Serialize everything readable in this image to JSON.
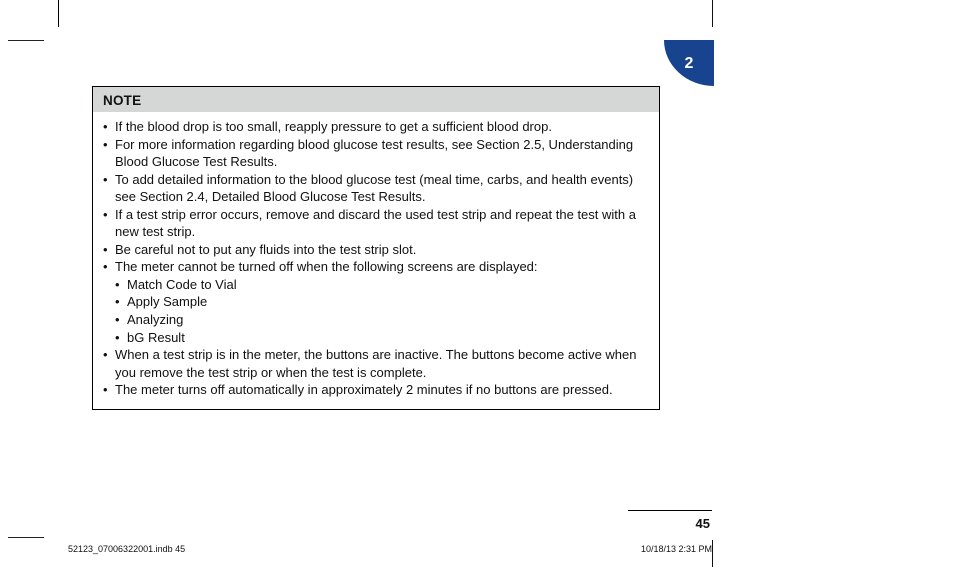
{
  "chapter_number": "2",
  "note": {
    "header": "NOTE",
    "items": [
      {
        "level": 1,
        "text": "If the blood drop is too small, reapply pressure to get a sufficient blood drop."
      },
      {
        "level": 1,
        "text": "For more information regarding blood glucose test results, see Section 2.5, Understanding Blood Glucose Test Results."
      },
      {
        "level": 1,
        "text": "To add detailed information to the blood glucose test (meal time, carbs, and health events) see Section 2.4, Detailed Blood Glucose Test Results."
      },
      {
        "level": 1,
        "text": "If a test strip error occurs, remove and discard the used test strip and repeat the test with a new test strip."
      },
      {
        "level": 1,
        "text": "Be careful not to put any fluids into the test strip slot."
      },
      {
        "level": 1,
        "text": "The meter cannot be turned off when the following screens are displayed:"
      },
      {
        "level": 2,
        "text": "Match Code to Vial"
      },
      {
        "level": 2,
        "text": "Apply Sample"
      },
      {
        "level": 2,
        "text": "Analyzing"
      },
      {
        "level": 2,
        "text": "bG Result"
      },
      {
        "level": 1,
        "text": "When a test strip is in the meter, the buttons are inactive. The buttons become active when you remove the test strip or when the test is complete."
      },
      {
        "level": 1,
        "text": "The meter turns off automatically in approximately 2 minutes if no buttons are pressed."
      }
    ]
  },
  "page_number": "45",
  "footer": {
    "left": "52123_07006322001.indb   45",
    "right": "10/18/13   2:31 PM"
  }
}
